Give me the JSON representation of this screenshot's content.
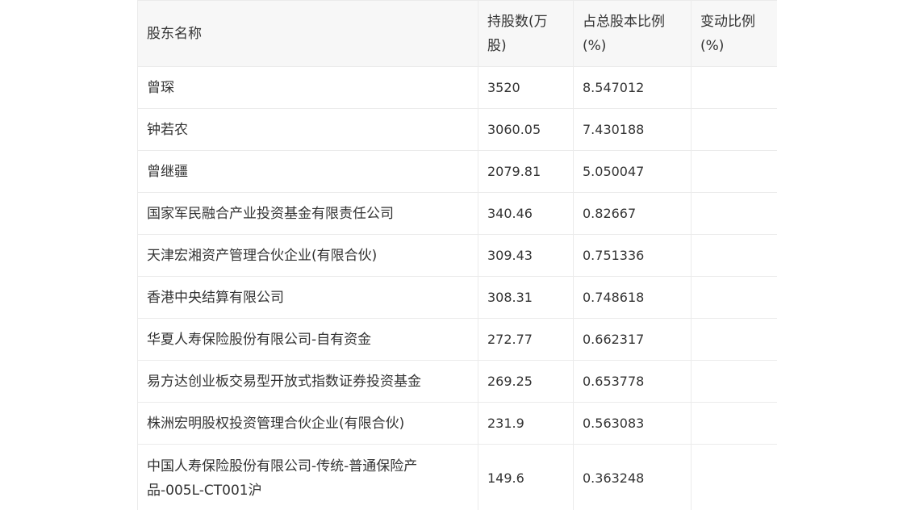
{
  "table": {
    "headers": [
      "股东名称",
      "持股数(万股)",
      "占总股本比例(%)",
      "变动比例(%)"
    ],
    "rows": [
      {
        "name": "曾琛",
        "shares": "3520",
        "ratio": "8.547012",
        "change": ""
      },
      {
        "name": "钟若农",
        "shares": "3060.05",
        "ratio": "7.430188",
        "change": ""
      },
      {
        "name": "曾继疆",
        "shares": "2079.81",
        "ratio": "5.050047",
        "change": ""
      },
      {
        "name": "国家军民融合产业投资基金有限责任公司",
        "shares": "340.46",
        "ratio": "0.82667",
        "change": ""
      },
      {
        "name": "天津宏湘资产管理合伙企业(有限合伙)",
        "shares": "309.43",
        "ratio": "0.751336",
        "change": ""
      },
      {
        "name": "香港中央结算有限公司",
        "shares": "308.31",
        "ratio": "0.748618",
        "change": ""
      },
      {
        "name": "华夏人寿保险股份有限公司-自有资金",
        "shares": "272.77",
        "ratio": "0.662317",
        "change": ""
      },
      {
        "name": "易方达创业板交易型开放式指数证券投资基金",
        "shares": "269.25",
        "ratio": "0.653778",
        "change": ""
      },
      {
        "name": "株洲宏明股权投资管理合伙企业(有限合伙)",
        "shares": "231.9",
        "ratio": "0.563083",
        "change": ""
      },
      {
        "name": "中国人寿保险股份有限公司-传统-普通保险产品-005L-CT001沪",
        "shares": "149.6",
        "ratio": "0.363248",
        "change": ""
      }
    ]
  }
}
